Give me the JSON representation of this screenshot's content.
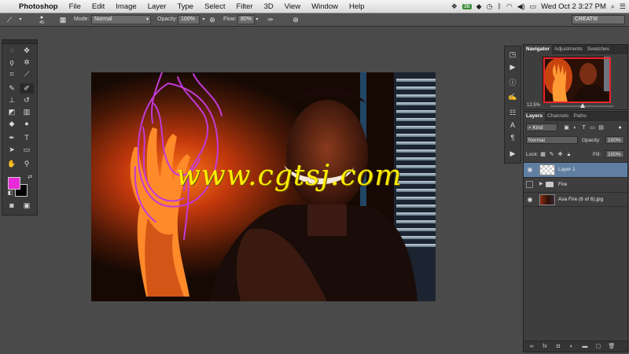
{
  "menubar": {
    "app_name": "Photoshop",
    "items": [
      "File",
      "Edit",
      "Image",
      "Layer",
      "Type",
      "Select",
      "Filter",
      "3D",
      "View",
      "Window",
      "Help"
    ],
    "badge": "38",
    "clock": "Wed Oct 2  3:27 PM"
  },
  "options": {
    "brush_size": "45",
    "mode_label": "Mode:",
    "mode_value": "Normal",
    "opacity_label": "Opacity:",
    "opacity_value": "100%",
    "flow_label": "Flow:",
    "flow_value": "80%",
    "workspace": "CREATIII"
  },
  "navigator": {
    "tabs": [
      "Navigator",
      "Adjustments",
      "Swatches"
    ],
    "zoom": "12.5%"
  },
  "layers": {
    "tabs": [
      "Layers",
      "Channels",
      "Paths"
    ],
    "filter_kind": "Kind",
    "blend_mode": "Normal",
    "opacity_label": "Opacity:",
    "opacity_value": "100%",
    "lock_label": "Lock:",
    "fill_label": "Fill:",
    "fill_value": "100%",
    "list": [
      {
        "name": "Layer 1",
        "selected": true
      },
      {
        "name": "Fire",
        "selected": false
      },
      {
        "name": "Asa Fire (6 of 6).jpg",
        "selected": false
      }
    ]
  },
  "canvas": {
    "watermark": "www.cgtsj.com"
  },
  "colors": {
    "foreground": "#e82ad8",
    "background": "#000000",
    "selection": "#5f7ea1",
    "brush_stroke": "#c23ad6"
  },
  "icons": {
    "tools": [
      "marquee-icon",
      "move-icon",
      "lasso-icon",
      "magic-wand-icon",
      "crop-icon",
      "eyedropper-icon",
      "healing-brush-icon",
      "brush-icon",
      "clone-stamp-icon",
      "history-brush-icon",
      "eraser-icon",
      "gradient-icon",
      "blur-icon",
      "dodge-icon",
      "pen-icon",
      "type-icon",
      "path-select-icon",
      "shape-icon",
      "hand-icon",
      "zoom-icon"
    ]
  }
}
